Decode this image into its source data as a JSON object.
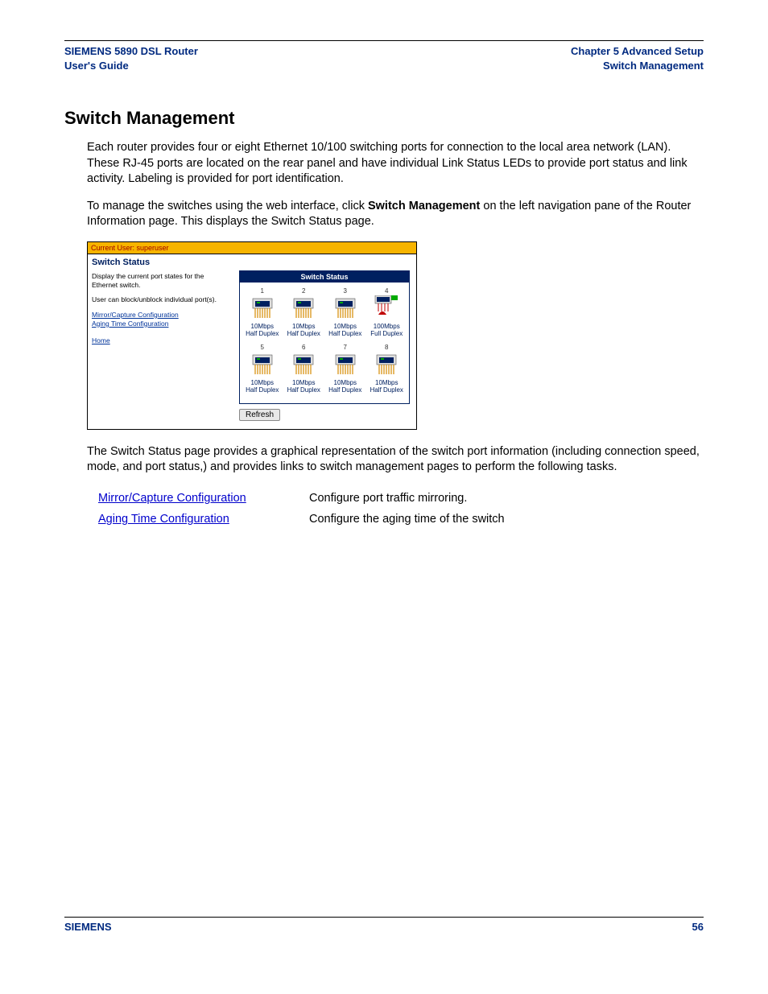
{
  "header": {
    "left_line1": "SIEMENS 5890 DSL Router",
    "left_line2": "User's Guide",
    "right_line1": "Chapter 5  Advanced Setup",
    "right_line2": "Switch Management"
  },
  "section_title": "Switch Management",
  "para1": "Each router provides four or eight Ethernet 10/100 switching ports for connection to the local area network (LAN). These RJ-45 ports are located on the rear panel and have individual Link Status LEDs to provide port status and link activity. Labeling is provided for port identification.",
  "para2_a": "To manage the switches using the web interface, click ",
  "para2_bold": "Switch Management",
  "para2_b": " on the left navigation pane of the Router Information page. This displays the Switch Status page.",
  "para3": "The Switch Status page provides a graphical representation of the switch port information (including connection speed, mode, and port status,) and provides links to switch management pages to perform the following tasks.",
  "links_table": [
    {
      "link": "Mirror/Capture Configuration",
      "desc": "Configure port traffic mirroring."
    },
    {
      "link": "Aging Time Configuration",
      "desc": "Configure the aging time of the switch"
    }
  ],
  "screenshot": {
    "userbar": "Current User: superuser",
    "left": {
      "title": "Switch Status",
      "p1": "Display the current port states for the Ethernet switch.",
      "p2": "User can block/unblock individual port(s).",
      "link1": "Mirror/Capture Configuration",
      "link2": "Aging Time Configuration",
      "link3": "Home"
    },
    "panel_title": "Switch Status",
    "ports": [
      {
        "num": "1",
        "speed": "10Mbps",
        "duplex": "Half Duplex",
        "variant": "normal"
      },
      {
        "num": "2",
        "speed": "10Mbps",
        "duplex": "Half Duplex",
        "variant": "normal"
      },
      {
        "num": "3",
        "speed": "10Mbps",
        "duplex": "Half Duplex",
        "variant": "normal"
      },
      {
        "num": "4",
        "speed": "100Mbps",
        "duplex": "Full Duplex",
        "variant": "active"
      },
      {
        "num": "5",
        "speed": "10Mbps",
        "duplex": "Half Duplex",
        "variant": "normal"
      },
      {
        "num": "6",
        "speed": "10Mbps",
        "duplex": "Half Duplex",
        "variant": "normal"
      },
      {
        "num": "7",
        "speed": "10Mbps",
        "duplex": "Half Duplex",
        "variant": "normal"
      },
      {
        "num": "8",
        "speed": "10Mbps",
        "duplex": "Half Duplex",
        "variant": "normal"
      }
    ],
    "refresh": "Refresh"
  },
  "footer": {
    "left": "SIEMENS",
    "right": "56"
  }
}
